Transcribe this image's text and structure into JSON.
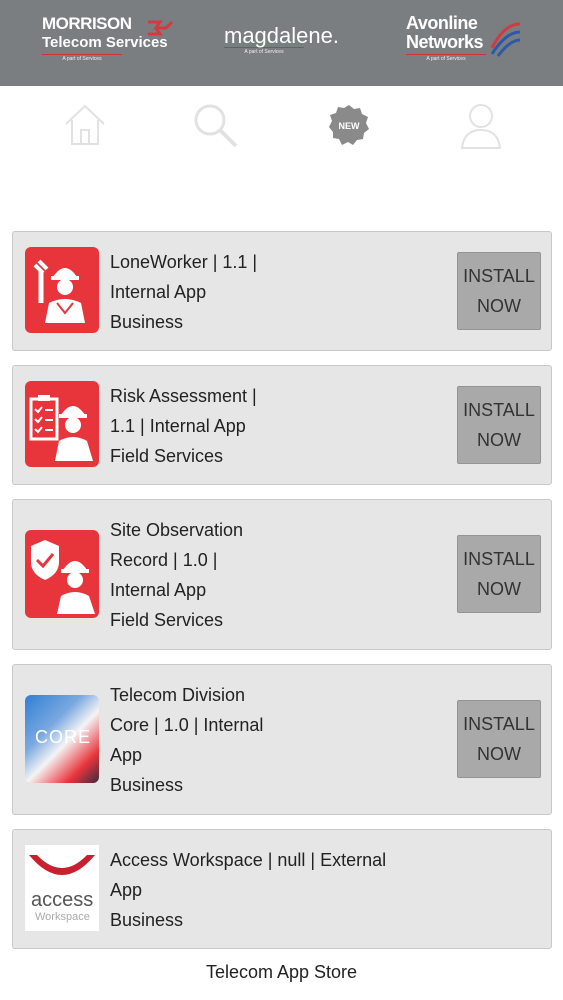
{
  "header": {
    "brands": [
      {
        "line1": "MORRISON",
        "line2": "Telecom Services",
        "sub": "A part of Services"
      },
      {
        "line1": "magdalene.",
        "sub": "A part of Services"
      },
      {
        "line1": "Avonline",
        "line2": "Networks",
        "sub": "A part of Services"
      }
    ]
  },
  "nav": {
    "new_badge": "NEW"
  },
  "apps": [
    {
      "lines": [
        "LoneWorker | 1.1 |",
        "Internal App",
        "Business"
      ],
      "install": [
        "INSTALL",
        "NOW"
      ]
    },
    {
      "lines": [
        "Risk Assessment |",
        "1.1 | Internal App",
        "Field Services"
      ],
      "install": [
        "INSTALL",
        "NOW"
      ]
    },
    {
      "lines": [
        "Site Observation",
        "Record | 1.0 |",
        "Internal App",
        "Field Services"
      ],
      "install": [
        "INSTALL",
        "NOW"
      ]
    },
    {
      "lines": [
        "Telecom Division",
        "Core | 1.0 | Internal",
        "App",
        "Business"
      ],
      "install": [
        "INSTALL",
        "NOW"
      ],
      "icon_text": "CORE"
    },
    {
      "lines": [
        "Access Workspace | null | External",
        "App",
        "Business"
      ],
      "icon_text": [
        "access",
        "Workspace"
      ]
    }
  ],
  "footer": {
    "label": "Telecom App Store"
  },
  "colors": {
    "header_bg": "#7b7e80",
    "accent_red": "#e8353c",
    "card_bg": "#e6e6e6",
    "button_bg": "#a9a9a9"
  }
}
